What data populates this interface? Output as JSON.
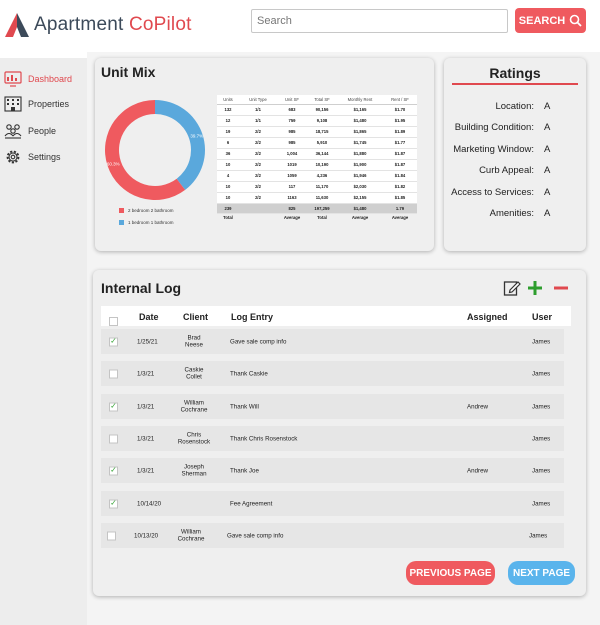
{
  "app": {
    "name_main": "Apartment ",
    "name_accent": "CoPilot",
    "brand_color": "#e0494f"
  },
  "search": {
    "placeholder": "Search",
    "value": "",
    "button_label": "SEARCH"
  },
  "sidebar": {
    "items": [
      {
        "label": "Dashboard",
        "icon": "dashboard-icon",
        "active": true
      },
      {
        "label": "Properties",
        "icon": "building-icon",
        "active": false
      },
      {
        "label": "People",
        "icon": "people-icon",
        "active": false
      },
      {
        "label": "Settings",
        "icon": "gear-icon",
        "active": false
      }
    ]
  },
  "unit_mix": {
    "title": "Unit Mix",
    "chart_data": {
      "type": "pie",
      "donut": true,
      "categories": [
        "2 bedroom 2 bathroom",
        "1 bedroom 1 bathroom"
      ],
      "values": [
        60.3,
        39.7
      ],
      "value_labels": [
        "60.3%",
        "39.7%"
      ],
      "colors": [
        "#ef5a5f",
        "#5aa8dc"
      ],
      "legend_position": "bottom-left"
    },
    "table": {
      "headers": [
        "Units",
        "Unit Type",
        "Unit SF",
        "Total SF",
        "Monthly Rent",
        "Rent / SF"
      ],
      "rows": [
        [
          "132",
          "1/1",
          "683",
          "90,156",
          "$1,165",
          "$1.70"
        ],
        [
          "12",
          "1/1",
          "759",
          "9,108",
          "$1,480",
          "$1.95"
        ],
        [
          "19",
          "2/2",
          "985",
          "18,715",
          "$1,865",
          "$1.89"
        ],
        [
          "6",
          "2/2",
          "985",
          "5,910",
          "$1,745",
          "$1.77"
        ],
        [
          "36",
          "2/2",
          "1,004",
          "36,144",
          "$1,880",
          "$1.87"
        ],
        [
          "10",
          "2/2",
          "1019",
          "10,190",
          "$1,900",
          "$1.87"
        ],
        [
          "4",
          "2/2",
          "1059",
          "4,236",
          "$1,946",
          "$1.84"
        ],
        [
          "10",
          "2/2",
          "117",
          "11,170",
          "$2,030",
          "$1.82"
        ],
        [
          "10",
          "2/2",
          "1163",
          "11,630",
          "$2,155",
          "$1.85"
        ]
      ],
      "total_row": [
        "239",
        "",
        "825",
        "197,259",
        "$1,480",
        "1.79"
      ],
      "footer_row": [
        "Total",
        "",
        "Average",
        "Total",
        "Average",
        "Average"
      ]
    }
  },
  "ratings": {
    "title": "Ratings",
    "items": [
      {
        "label": "Location:",
        "value": "A"
      },
      {
        "label": "Building Condition:",
        "value": "A"
      },
      {
        "label": "Marketing Window:",
        "value": "A"
      },
      {
        "label": "Curb Appeal:",
        "value": "A"
      },
      {
        "label": "Access to Services:",
        "value": "A"
      },
      {
        "label": "Amenities:",
        "value": "A"
      }
    ]
  },
  "log": {
    "title": "Internal Log",
    "headers": {
      "date": "Date",
      "client": "Client",
      "entry": "Log Entry",
      "assigned": "Assigned",
      "user": "User"
    },
    "rows": [
      {
        "checked": true,
        "date": "1/25/21",
        "client_l1": "Brad",
        "client_l2": "Neese",
        "entry": "Gave sale comp info",
        "assigned": "",
        "user": "James"
      },
      {
        "checked": false,
        "date": "1/3/21",
        "client_l1": "Caskie",
        "client_l2": "Collet",
        "entry": "Thank Caskie",
        "assigned": "",
        "user": "James"
      },
      {
        "checked": true,
        "date": "1/3/21",
        "client_l1": "William",
        "client_l2": "Cochrane",
        "entry": "Thank Will",
        "assigned": "Andrew",
        "user": "James"
      },
      {
        "checked": false,
        "date": "1/3/21",
        "client_l1": "Chris",
        "client_l2": "Rosenstock",
        "entry": "Thank Chris Rosenstock",
        "assigned": "",
        "user": "James"
      },
      {
        "checked": true,
        "date": "1/3/21",
        "client_l1": "Joseph",
        "client_l2": "Sherman",
        "entry": "Thank Joe",
        "assigned": "Andrew",
        "user": "James"
      },
      {
        "checked": true,
        "date": "10/14/20",
        "client_l1": "",
        "client_l2": "",
        "entry": "Fee Agreement",
        "assigned": "",
        "user": "James"
      },
      {
        "checked": false,
        "date": "10/13/20",
        "client_l1": "William",
        "client_l2": "Cochrane",
        "entry": "Gave sale comp info",
        "assigned": "",
        "user": "James"
      }
    ],
    "prev_label": "PREVIOUS PAGE",
    "next_label": "NEXT PAGE",
    "icons": [
      "edit-icon",
      "plus-icon",
      "minus-icon"
    ]
  }
}
